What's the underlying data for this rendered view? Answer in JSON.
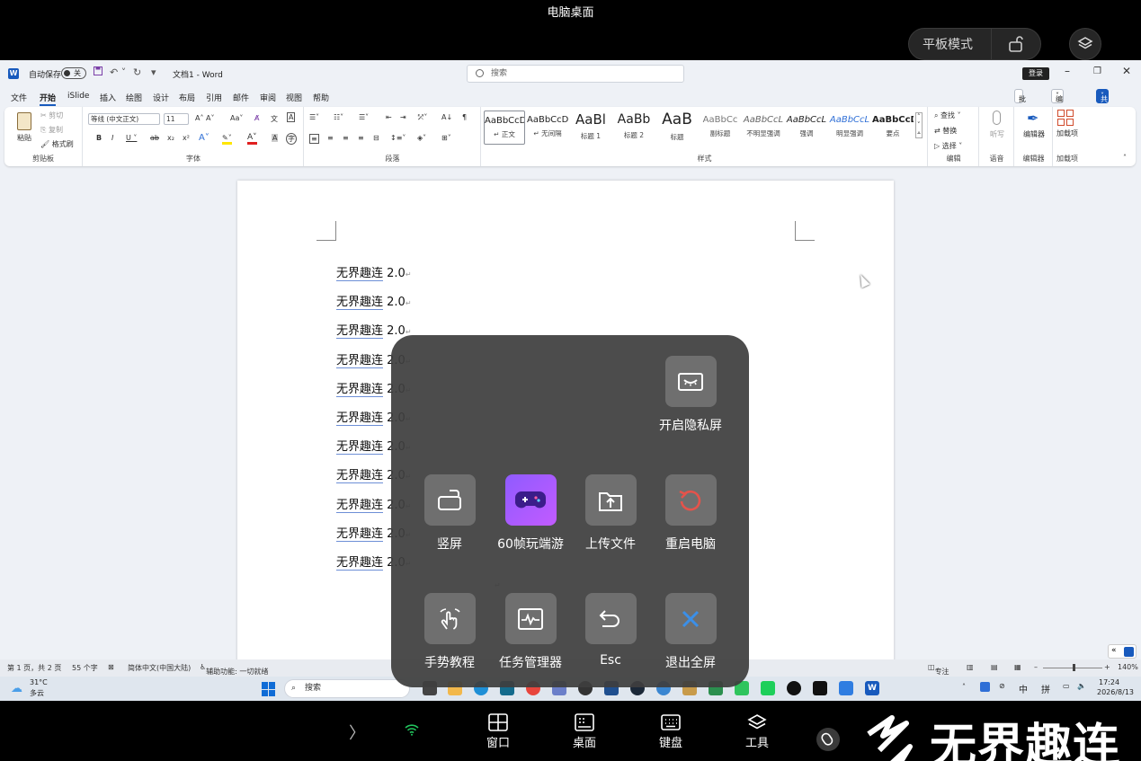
{
  "top_title": "电脑桌面",
  "tablet_mode_label": "平板模式",
  "word": {
    "autosave_label": "自动保存",
    "autosave_state": "关",
    "doc_title": "文档1  -  Word",
    "search_placeholder": "搜索",
    "login_label": "登录",
    "menu": [
      "文件",
      "开始",
      "iSlide",
      "插入",
      "绘图",
      "设计",
      "布局",
      "引用",
      "邮件",
      "审阅",
      "视图",
      "帮助"
    ],
    "comments_label": "批注",
    "editing_label": "编辑",
    "share_label": "共享",
    "ribbon": {
      "paste": "粘贴",
      "cut": "剪切",
      "copy": "复制",
      "format_painter": "格式刷",
      "clipboard_group": "剪贴板",
      "font_name": "等线 (中文正文)",
      "font_size": "11",
      "font_group": "字体",
      "paragraph_group": "段落",
      "styles_group": "样式",
      "find": "查找",
      "replace": "替换",
      "select": "选择",
      "editing_group": "编辑",
      "dictate": "听写",
      "voice_group": "语音",
      "editor": "编辑器",
      "editor_group": "编辑器",
      "addins": "加载项",
      "addins_group": "加载项"
    },
    "styles": [
      {
        "preview": "AaBbCcD",
        "name": "↵ 正文"
      },
      {
        "preview": "AaBbCcD",
        "name": "↵ 无间隔"
      },
      {
        "preview": "AaBl",
        "name": "标题 1"
      },
      {
        "preview": "AaBb",
        "name": "标题 2"
      },
      {
        "preview": "AaB",
        "name": "标题"
      },
      {
        "preview": "AaBbCc",
        "name": "副标题"
      },
      {
        "preview": "AaBbCcL",
        "name": "不明显强调"
      },
      {
        "preview": "AaBbCcL",
        "name": "强调"
      },
      {
        "preview": "AaBbCcL",
        "name": "明显强调"
      },
      {
        "preview": "AaBbCcD",
        "name": "要点"
      }
    ],
    "doc_lines": [
      {
        "word": "无界趣连",
        "rest": " 2.0"
      },
      {
        "word": "无界趣连",
        "rest": " 2.0"
      },
      {
        "word": "无界趣连",
        "rest": " 2.0"
      },
      {
        "word": "无界趣连",
        "rest": " 2.0"
      },
      {
        "word": "无界趣连",
        "rest": " 2.0"
      },
      {
        "word": "无界趣连",
        "rest": " 2.0"
      },
      {
        "word": "无界趣连",
        "rest": " 2.0"
      },
      {
        "word": "无界趣连",
        "rest": " 2.0"
      },
      {
        "word": "无界趣连",
        "rest": " 2.0"
      },
      {
        "word": "无界趣连",
        "rest": " 2.0"
      },
      {
        "word": "无界趣连",
        "rest": " 2.0"
      }
    ],
    "status": {
      "page": "第 1 页，共 2 页",
      "words": "55 个字",
      "language": "简体中文(中国大陆)",
      "accessibility": "辅助功能: 一切就绪",
      "focus": "专注",
      "zoom": "140%"
    }
  },
  "taskbar": {
    "weather_temp": "31°C",
    "weather_desc": "多云",
    "search_label": "搜索",
    "ime1": "中",
    "ime2": "拼",
    "time": "17:24",
    "date": "2026/8/13"
  },
  "panel": {
    "privacy": "开启隐私屏",
    "portrait": "竖屏",
    "game": "60帧玩端游",
    "upload": "上传文件",
    "restart": "重启电脑",
    "gesture": "手势教程",
    "task_manager": "任务管理器",
    "esc": "Esc",
    "exit_fullscreen": "退出全屏"
  },
  "bottom": {
    "window": "窗口",
    "desktop": "桌面",
    "keyboard": "键盘",
    "tools": "工具",
    "brand": "无界趣连"
  },
  "colors": {
    "word_blue": "#185abd",
    "panel_bg": "#3e3e3e",
    "restart_red": "#e5534b",
    "exit_blue": "#3b8fe8",
    "wifi_green": "#22c55e"
  }
}
